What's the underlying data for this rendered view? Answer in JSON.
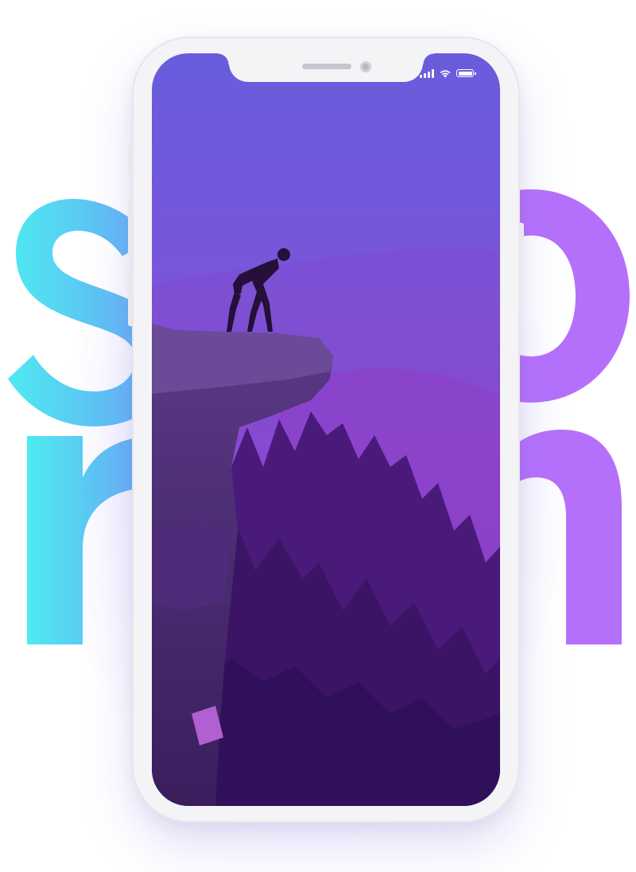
{
  "background_letters": {
    "top": "so",
    "bottom": "rn",
    "left_gradient": [
      "#4eeaf0",
      "#63a8f7"
    ],
    "right_color": "#b570fb"
  },
  "phone": {
    "body_color": "#f4f4f7",
    "status_bar": {
      "signal_icon": "cellular-signal-icon",
      "wifi_icon": "wifi-icon",
      "battery_icon": "battery-icon"
    }
  },
  "wallpaper": {
    "description_colors": {
      "top": "#6a5bdc",
      "mid": "#8a48d6",
      "bottom": "#3a1363"
    }
  }
}
